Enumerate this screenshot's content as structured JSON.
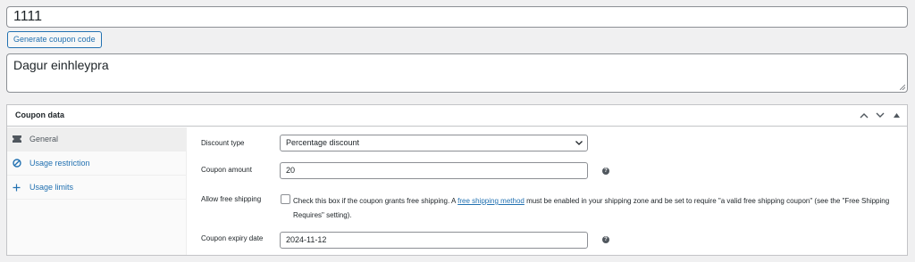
{
  "coupon": {
    "code": "1111",
    "generate_label": "Generate coupon code",
    "description": "Dagur einhleypra"
  },
  "panel": {
    "title": "Coupon data",
    "tabs": [
      {
        "label": "General",
        "icon": "ticket-icon"
      },
      {
        "label": "Usage restriction",
        "icon": "restriction-icon"
      },
      {
        "label": "Usage limits",
        "icon": "plus-icon"
      }
    ]
  },
  "fields": {
    "discount_type_label": "Discount type",
    "discount_type_value": "Percentage discount",
    "amount_label": "Coupon amount",
    "amount_value": "20",
    "free_shipping_label": "Allow free shipping",
    "free_shipping_before": "Check this box if the coupon grants free shipping. A ",
    "free_shipping_link": "free shipping method",
    "free_shipping_after": " must be enabled in your shipping zone and be set to require \"a valid free shipping coupon\" (see the \"Free Shipping Requires\" setting).",
    "free_shipping_checked": false,
    "expiry_label": "Coupon expiry date",
    "expiry_value": "2024-11-12"
  },
  "colors": {
    "accent": "#2271b1",
    "text": "#1d2327",
    "background": "#f0f0f1"
  }
}
